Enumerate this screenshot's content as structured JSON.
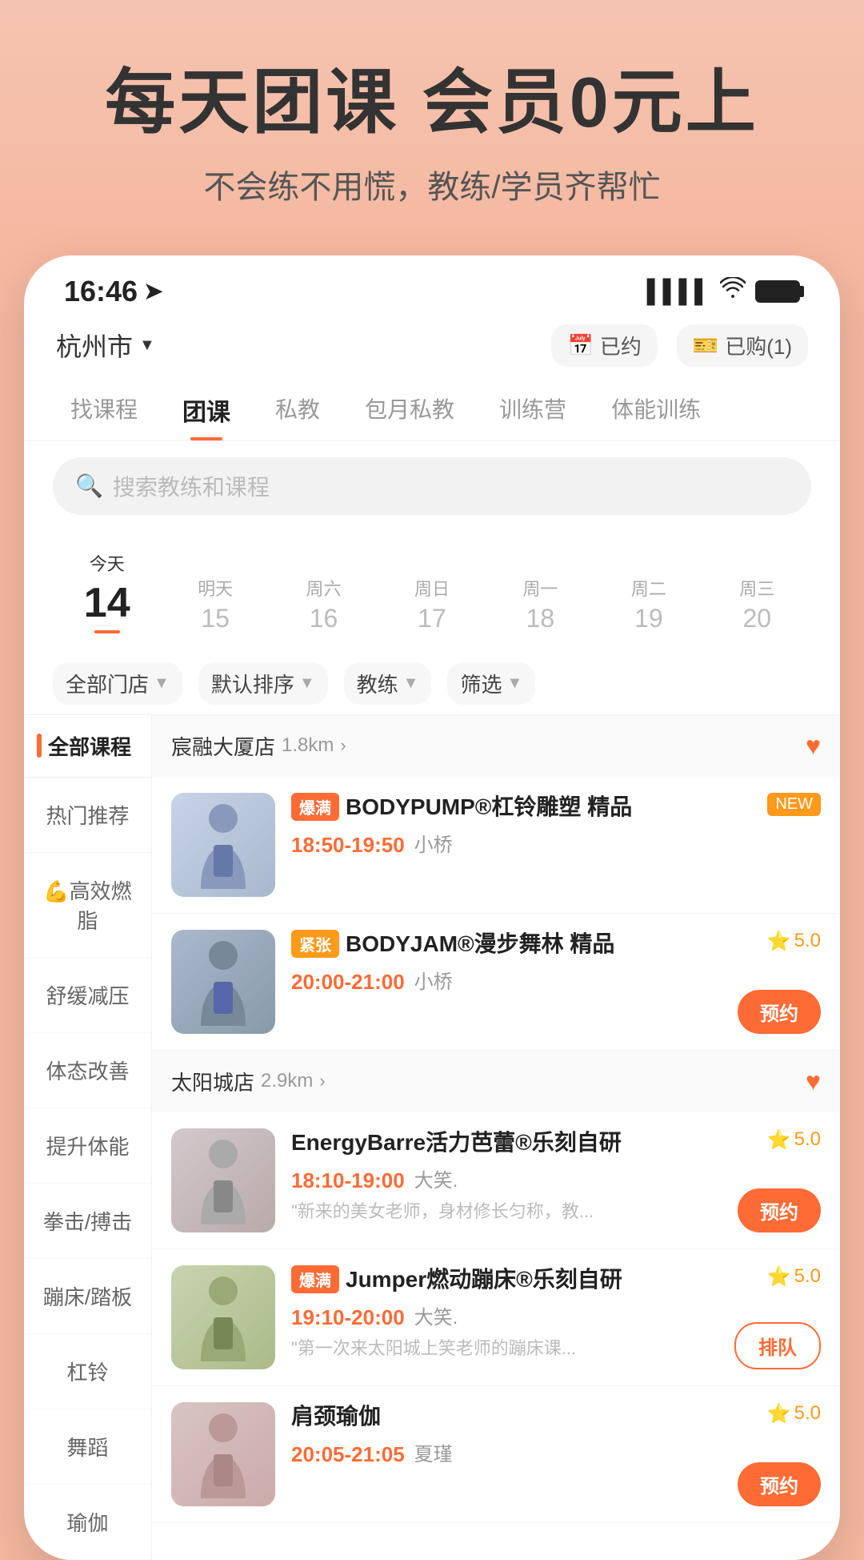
{
  "hero": {
    "title": "每天团课 会员0元上",
    "subtitle": "不会练不用慌，教练/学员齐帮忙"
  },
  "statusBar": {
    "time": "16:46",
    "locationArrow": "➤"
  },
  "topNav": {
    "location": "杭州市",
    "reserved": "已约",
    "purchased": "已购(1)"
  },
  "tabs": [
    {
      "label": "找课程",
      "active": false
    },
    {
      "label": "团课",
      "active": true
    },
    {
      "label": "私教",
      "active": false
    },
    {
      "label": "包月私教",
      "active": false
    },
    {
      "label": "训练营",
      "active": false
    },
    {
      "label": "体能训练",
      "active": false
    }
  ],
  "search": {
    "placeholder": "搜索教练和课程"
  },
  "dates": [
    {
      "label": "今天",
      "num": "14",
      "today": true
    },
    {
      "label": "明天",
      "num": "15",
      "today": false
    },
    {
      "label": "周六",
      "num": "16",
      "today": false
    },
    {
      "label": "周日",
      "num": "17",
      "today": false
    },
    {
      "label": "周一",
      "num": "18",
      "today": false
    },
    {
      "label": "周二",
      "num": "19",
      "today": false
    },
    {
      "label": "周三",
      "num": "20",
      "today": false
    }
  ],
  "filters": [
    {
      "label": "全部门店"
    },
    {
      "label": "默认排序"
    },
    {
      "label": "教练"
    },
    {
      "label": "筛选"
    }
  ],
  "sidebar": {
    "header": "全部课程",
    "items": [
      {
        "label": "热门推荐"
      },
      {
        "label": "💪高效燃脂"
      },
      {
        "label": "舒缓减压"
      },
      {
        "label": "体态改善"
      },
      {
        "label": "提升体能"
      },
      {
        "label": "拳击/搏击"
      },
      {
        "label": "蹦床/踏板"
      },
      {
        "label": "杠铃"
      },
      {
        "label": "舞蹈"
      },
      {
        "label": "瑜伽"
      }
    ]
  },
  "stores": [
    {
      "name": "宸融大厦店",
      "distance": "1.8km",
      "liked": true,
      "courses": [
        {
          "tag": "爆满",
          "tagType": "full",
          "name": "BODYPUMP®杠铃雕塑 精品",
          "time": "18:50-19:50",
          "trainer": "小桥",
          "isNew": true,
          "rating": null,
          "hasBookBtn": false,
          "hasQueueBtn": false,
          "desc": ""
        },
        {
          "tag": "紧张",
          "tagType": "tight",
          "name": "BODYJAM®漫步舞林 精品",
          "time": "20:00-21:00",
          "trainer": "小桥",
          "isNew": false,
          "rating": "5.0",
          "hasBookBtn": true,
          "hasQueueBtn": false,
          "desc": ""
        }
      ]
    },
    {
      "name": "太阳城店",
      "distance": "2.9km",
      "liked": true,
      "courses": [
        {
          "tag": "",
          "tagType": "",
          "name": "EnergyBarre活力芭蕾®乐刻自研",
          "time": "18:10-19:00",
          "trainer": "大笑.",
          "isNew": false,
          "rating": "5.0",
          "hasBookBtn": true,
          "hasQueueBtn": false,
          "desc": "\"新来的美女老师，身材修长匀称，教..."
        },
        {
          "tag": "爆满",
          "tagType": "full",
          "name": "Jumper燃动蹦床®乐刻自研",
          "time": "19:10-20:00",
          "trainer": "大笑.",
          "isNew": false,
          "rating": "5.0",
          "hasBookBtn": false,
          "hasQueueBtn": true,
          "desc": "\"第一次来太阳城上笑老师的蹦床课..."
        },
        {
          "tag": "",
          "tagType": "",
          "name": "肩颈瑜伽",
          "time": "20:05-21:05",
          "trainer": "夏瑾",
          "isNew": false,
          "rating": "5.0",
          "hasBookBtn": true,
          "hasQueueBtn": false,
          "desc": ""
        }
      ]
    }
  ]
}
